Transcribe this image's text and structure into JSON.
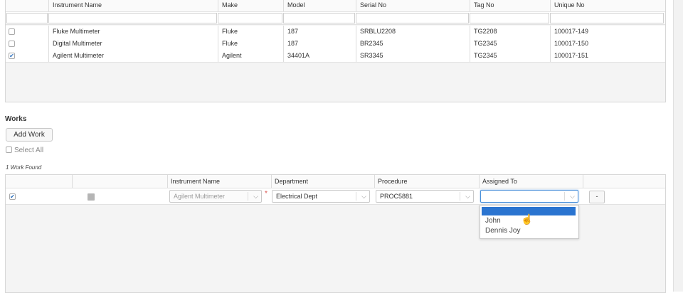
{
  "instruments_grid": {
    "columns": [
      "Instrument Name",
      "Make",
      "Model",
      "Serial No",
      "Tag No",
      "Unique No"
    ],
    "rows": [
      {
        "checked": false,
        "name": "Fluke Multimeter",
        "make": "Fluke",
        "model": "187",
        "serial": "SRBLU2208",
        "tag": "TG2208",
        "unique": "100017-149"
      },
      {
        "checked": false,
        "name": "Digital Multimeter",
        "make": "Fluke",
        "model": "187",
        "serial": "BR2345",
        "tag": "TG2345",
        "unique": "100017-150"
      },
      {
        "checked": true,
        "name": "Agilent Multimeter",
        "make": "Agilent",
        "model": "34401A",
        "serial": "SR3345",
        "tag": "TG2345",
        "unique": "100017-151"
      }
    ]
  },
  "works": {
    "title": "Works",
    "add_button": "Add Work",
    "select_all": "Select All",
    "found_text": "1 Work Found",
    "columns": [
      "Instrument Name",
      "Department",
      "Procedure",
      "Assigned To"
    ],
    "row": {
      "checked": true,
      "instrument": "Agilent Multimeter",
      "required_mark": "*",
      "department": "Electrical Dept",
      "procedure": "PROC5881",
      "assigned_to": "",
      "remove_label": "-"
    },
    "assigned_options": [
      "John",
      "Dennis Joy"
    ]
  },
  "icons": {
    "check": "✔",
    "chevron": "⌵"
  },
  "colors": {
    "accent": "#2a74d0"
  }
}
